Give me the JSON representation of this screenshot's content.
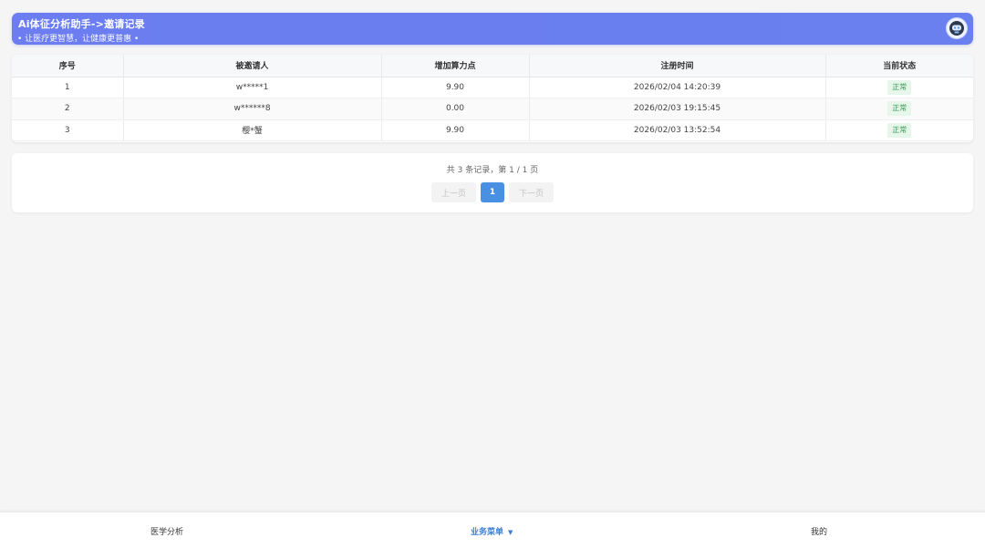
{
  "header": {
    "title": "Ai体征分析助手->邀请记录",
    "subtitle": "• 让医疗更智慧，让健康更普惠 •",
    "avatar_icon": "robot-avatar-icon"
  },
  "table": {
    "columns": [
      "序号",
      "被邀请人",
      "增加算力点",
      "注册时间",
      "当前状态"
    ],
    "rows": [
      {
        "index": "1",
        "invitee": "w*****1",
        "points": "9.90",
        "registered": "2026/02/04 14:20:39",
        "status": "正常"
      },
      {
        "index": "2",
        "invitee": "w******8",
        "points": "0.00",
        "registered": "2026/02/03 19:15:45",
        "status": "正常"
      },
      {
        "index": "3",
        "invitee": "樱*蟹",
        "points": "9.90",
        "registered": "2026/02/03 13:52:54",
        "status": "正常"
      }
    ]
  },
  "pagination": {
    "info": "共 3 条记录，第 1 / 1 页",
    "prev": "上一页",
    "current": "1",
    "next": "下一页"
  },
  "bottom_nav": {
    "left": "医学分析",
    "center": "业务菜单",
    "center_caret": "▼",
    "right": "我的"
  },
  "colors": {
    "header": "#6b7df0",
    "accent": "#4a90e2",
    "status_bg": "#e6f6ea",
    "status_text": "#3a9a55"
  }
}
